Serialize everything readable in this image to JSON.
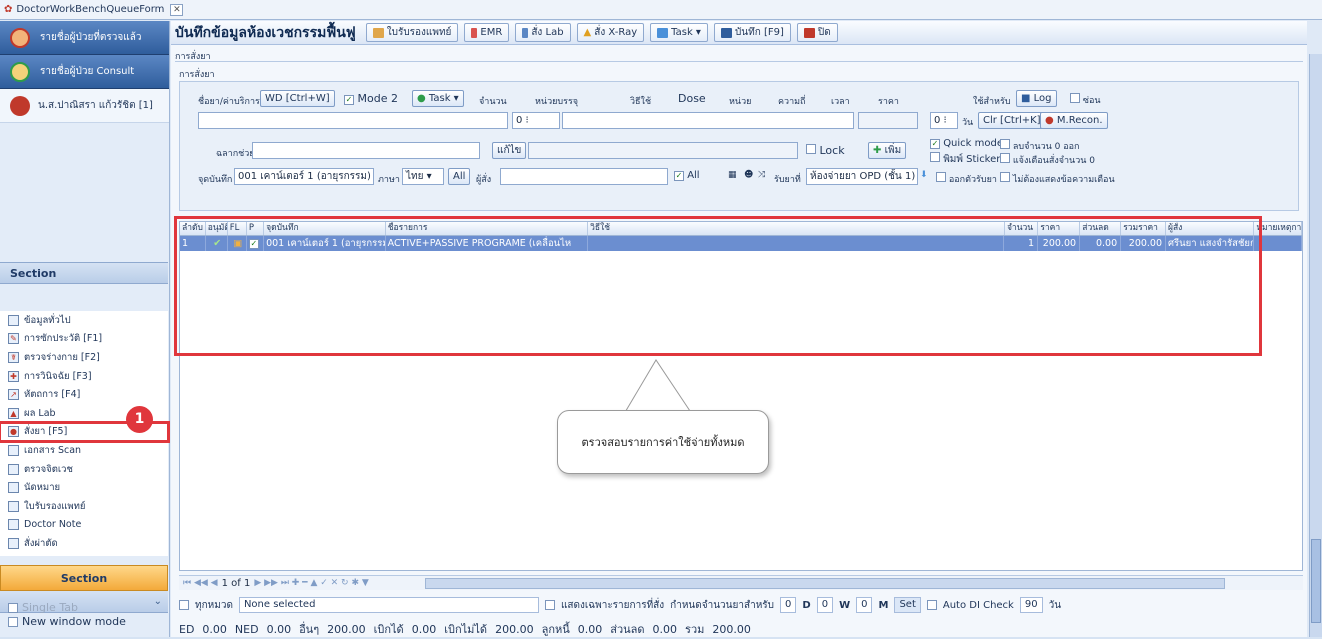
{
  "window": {
    "tab_title": "DoctorWorkBenchQueueForm"
  },
  "left": {
    "btn_checked": "รายชื่อผู้ป่วยที่ตรวจแล้ว",
    "btn_consult": "รายชื่อผู้ป่วย Consult",
    "patient_name": "น.ส.ปาณิสรา แก้วรัชิต [1]",
    "section_head": "Section",
    "section_items": [
      "ข้อมูลทั่วไป",
      "การซักประวัติ [F1]",
      "ตรวจร่างกาย [F2]",
      "การวินิจฉัย [F3]",
      "หัตถการ [F4]",
      "ผล Lab",
      "สั่งยา [F5]",
      "เอกสาร Scan",
      "ตรวจจิตเวช",
      "นัดหมาย",
      "ใบรับรองแพทย์",
      "Doctor Note",
      "สั่งผ่าตัด"
    ],
    "section_btn": "Section",
    "single_tab": "Single Tab",
    "new_window": "New window mode"
  },
  "toolbar": {
    "title": "บันทึกข้อมูลห้องเวชกรรมฟื้นฟู",
    "cert": "ใบรับรองแพทย์",
    "emr": "EMR",
    "lab": "สั่ง Lab",
    "xray": "สั่ง X-Ray",
    "task": "Task ▾",
    "save": "บันทึก [F9]",
    "close": "ปิด"
  },
  "labels": {
    "order_title": "การสั่งยา",
    "order_sub": "การสั่งยา"
  },
  "form": {
    "item_label": "ชื่อยา/ค่าบริการ",
    "wd_btn": "WD [Ctrl+W]",
    "mode2": "Mode 2",
    "task": "Task ▾",
    "qty_label": "จำนวน",
    "unit_label": "หน่วยบรรจุ",
    "usage_label": "วิธีใช้",
    "dose_label": "Dose",
    "dunit_label": "หน่วย",
    "freq_label": "ความถี่",
    "time_label": "เวลา",
    "price_label": "ราคา",
    "for_label": "ใช้สำหรับ",
    "log_btn": "Log",
    "hide_label": "ซ่อน",
    "qty_value": "0",
    "days_value": "0",
    "days_label": "วัน",
    "clr_btn": "Clr [Ctrl+K]",
    "mrecon_btn": "M.Recon.",
    "label_label": "ฉลากช่วย",
    "edit_btn": "แก้ไข",
    "lock_label": "Lock",
    "add_btn": "เพิ่ม",
    "quick_mode": "Quick mode",
    "qty0": "ลบจำนวน 0 ออก",
    "sticker": "พิมพ์ Sticker",
    "warn_qty": "แจ้งเตือนสั่งจำนวน 0",
    "point_label": "จุดบันทึก",
    "point_value": "001 เคาน์เตอร์ 1 (อายุรกรรม)",
    "lang_label": "ภาษา",
    "lang_value": "ไทย",
    "all_btn": "All",
    "orderer_label": "ผู้สั่ง",
    "all_label": "All",
    "pay_label": "รับยาที่",
    "pay_value": "ห้องจ่ายยา OPD (ชั้น 1)",
    "out_label": "ออกตัวรับยา",
    "no_msg": "ไม่ต้องแสดงข้อความเตือน"
  },
  "grid": {
    "headers": [
      "ลำดับ",
      "อนุมัติ",
      "FL",
      "P",
      "จุดบันทึก",
      "ชื่อรายการ",
      "วิธีใช้",
      "จำนวน",
      "ราคา",
      "ส่วนลด",
      "รวมราคา",
      "ผู้สั่ง",
      "หมายเหตุการ"
    ],
    "row": {
      "seq": "1",
      "point": "001 เคาน์เตอร์ 1 (อายุรกรรม)",
      "name": "ACTIVE+PASSIVE PROGRAME (เคลื่อนไห",
      "usage": "",
      "qty": "1",
      "price": "200.00",
      "discount": "0.00",
      "total": "200.00",
      "orderer": "ศรีนยา แสงจำรัสชัยกุล(BMS)",
      "note": ""
    }
  },
  "annotation": {
    "callout": "ตรวจสอบรายการค่าใช้จ่ายทั้งหมด",
    "badge": "1"
  },
  "nav": {
    "page": "1 of 1"
  },
  "bottom": {
    "all_doc": "ทุกหมวด",
    "none_selected": "None selected",
    "only_ordered": "แสดงเฉพาะรายการที่สั่ง",
    "set_qty": "กำหนดจำนวนยาสำหรับ",
    "d_val": "0",
    "d_label": "D",
    "w_val": "0",
    "w_label": "W",
    "m_val": "0",
    "m_label": "M",
    "set_btn": "Set",
    "auto_di": "Auto DI Check",
    "di_val": "90",
    "di_unit": "วัน",
    "ed_label": "ED",
    "ed_val": "0.00",
    "ned_label": "NED",
    "ned_val": "0.00",
    "other_label": "อื่นๆ",
    "other_val": "200.00",
    "claim_label": "เบิกได้",
    "claim_val": "0.00",
    "noclaim_label": "เบิกไม่ได้",
    "noclaim_val": "200.00",
    "debt_label": "ลูกหนี้",
    "debt_val": "0.00",
    "disc_label": "ส่วนลด",
    "disc_val": "0.00",
    "sum_label": "รวม",
    "sum_val": "200.00"
  },
  "colors": {
    "accent": "#2f5d9c",
    "highlight": "#e0363c",
    "selected_row": "#6b8ed0"
  }
}
